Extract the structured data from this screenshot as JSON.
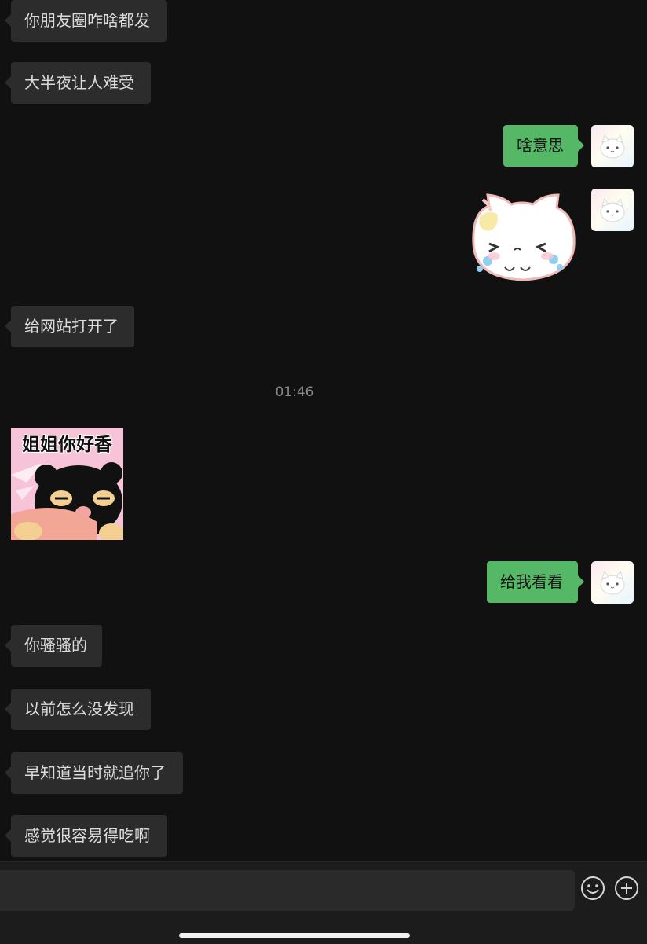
{
  "messages": [
    {
      "side": "in",
      "text": "你朋友圈咋啥都发"
    },
    {
      "side": "in",
      "text": "大半夜让人难受"
    },
    {
      "side": "out",
      "text": "啥意思"
    },
    {
      "side": "out",
      "type": "sticker",
      "sticker": "crying-cat-sticker"
    },
    {
      "side": "in",
      "text": "给网站打开了"
    },
    {
      "type": "timestamp",
      "text": "01:46"
    },
    {
      "side": "in",
      "type": "sticker",
      "sticker": "bear-sticker",
      "caption": "姐姐你好香"
    },
    {
      "side": "out",
      "text": "给我看看"
    },
    {
      "side": "in",
      "text": "你骚骚的"
    },
    {
      "side": "in",
      "text": "以前怎么没发现"
    },
    {
      "side": "in",
      "text": "早知道当时就追你了"
    },
    {
      "side": "in",
      "text": "感觉很容易得吃啊"
    }
  ],
  "composer": {
    "input_value": "",
    "emoji_icon": "smile-face-icon",
    "more_icon": "plus-circle-icon"
  },
  "colors": {
    "background": "#111111",
    "incoming_bubble": "#2c2c2c",
    "outgoing_bubble": "#55b866",
    "timestamp": "#8a8a8a"
  }
}
